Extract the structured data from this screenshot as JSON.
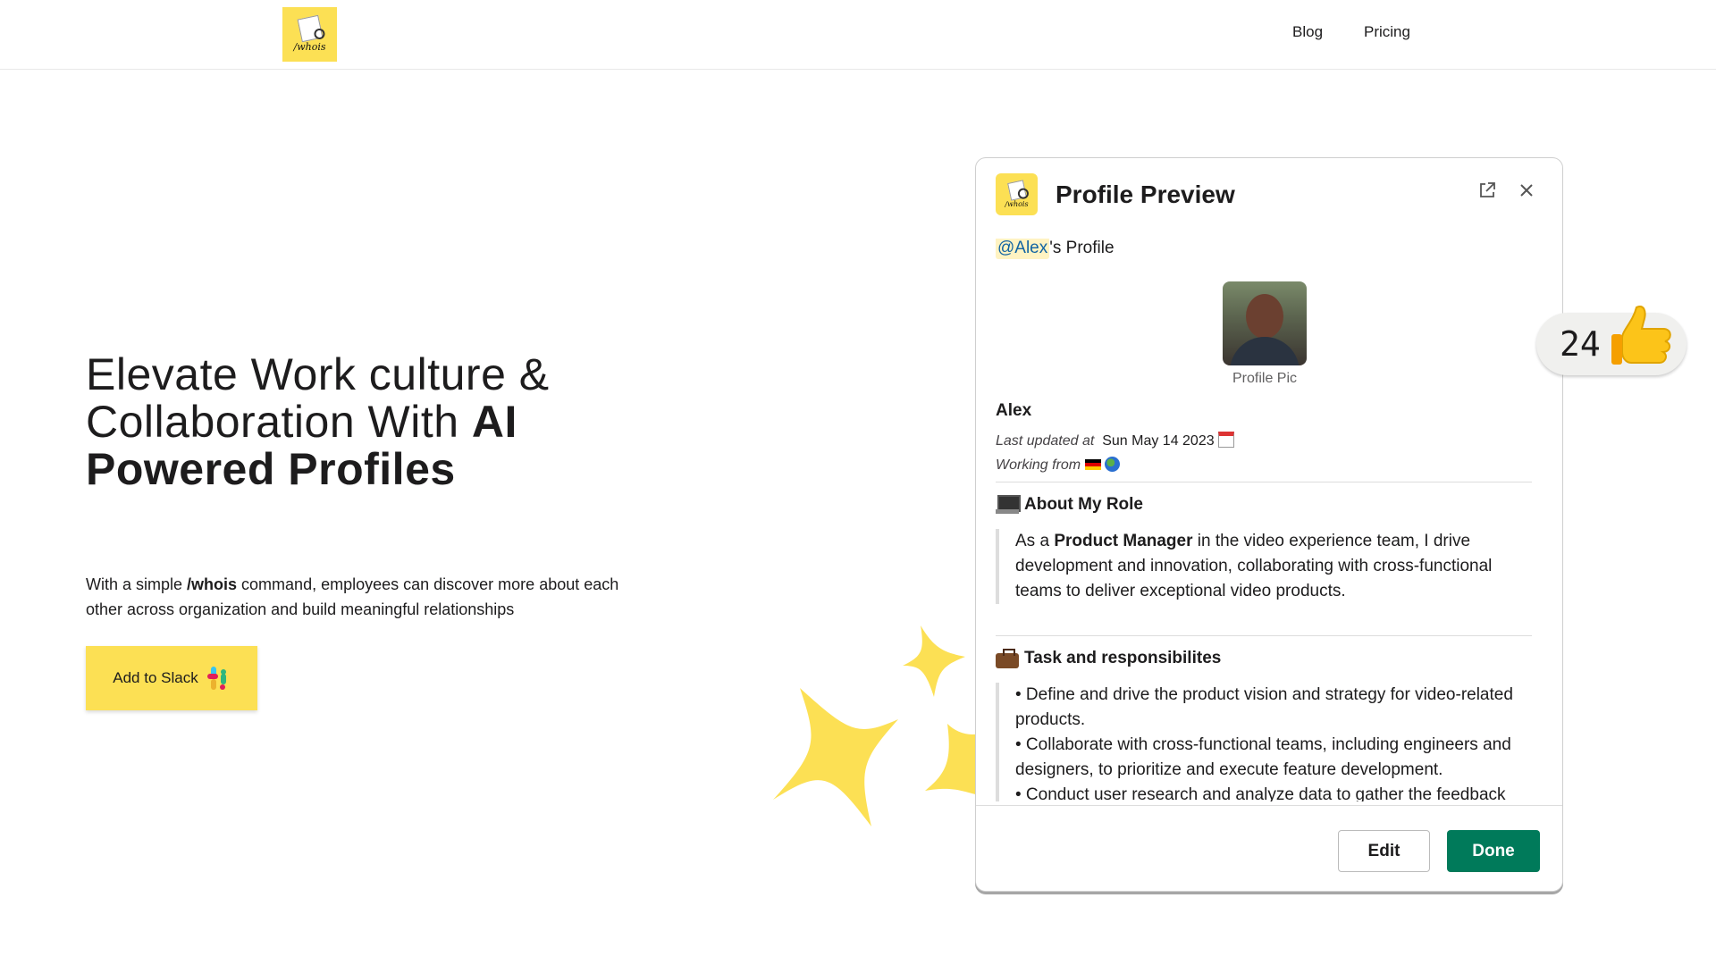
{
  "header": {
    "logo_text": "/whois",
    "nav": {
      "blog": "Blog",
      "pricing": "Pricing"
    }
  },
  "hero": {
    "title_line1": "Elevate Work culture &",
    "title_line2_plain": "Collaboration With ",
    "title_line2_bold": "AI",
    "title_line3_bold": "Powered Profiles",
    "sub_prefix": "With a simple ",
    "sub_command": "/whois",
    "sub_suffix": " command, employees can discover more about each other across organization and build meaningful relationships",
    "cta_label": "Add to Slack"
  },
  "card": {
    "title": "Profile Preview",
    "logo_text": "/whois",
    "mention": "@Alex",
    "mention_suffix": "'s Profile",
    "pic_caption": "Profile Pic",
    "name": "Alex",
    "updated_label": "Last updated at",
    "updated_value": "Sun May 14 2023",
    "working_label": "Working from",
    "role_title": "About My Role",
    "role_prefix": "As a ",
    "role_bold": "Product Manager",
    "role_suffix": " in the video experience team, I drive development and innovation, collaborating with cross-functional teams to deliver exceptional video products.",
    "tasks_title": "Task and responsibilites",
    "tasks": [
      "• Define and drive the product vision and strategy for video-related products.",
      "• Collaborate with cross-functional teams, including engineers and designers, to prioritize and execute feature development.",
      "• Conduct user research and analyze data to gather the feedback into"
    ],
    "edit_label": "Edit",
    "done_label": "Done"
  },
  "reaction": {
    "count": "24",
    "emoji": "thumbs-up-icon"
  },
  "colors": {
    "brand_yellow": "#fce054",
    "done_green": "#007a5a",
    "mention_blue": "#1264a3"
  }
}
